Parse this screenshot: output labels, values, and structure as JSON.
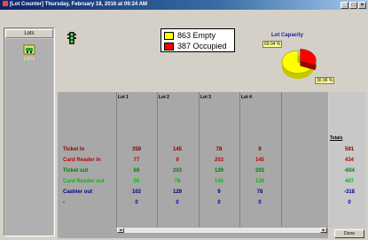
{
  "window": {
    "title": "[Lot Counter] Thursday, February  18, 2016 at 09:24 AM",
    "controls": [
      "_",
      "□",
      "×"
    ]
  },
  "lots_panel": {
    "header": "Lots",
    "item_label": "LOT1",
    "item_icon": "parking-lot-icon"
  },
  "status_icon": "traffic-light-icon",
  "legend": {
    "empty_label": "863 Empty",
    "occupied_label": "387 Occupied",
    "empty_color": "#ffff00",
    "occupied_color": "#ff0000"
  },
  "capacity": {
    "title": "Lot Capacity",
    "empty_pct_label": "69.04 %",
    "occupied_pct_label": "30.96 %",
    "empty_fraction": 0.6904,
    "occupied_fraction": 0.3096
  },
  "table": {
    "columns": [
      "Lot 1",
      "Lot 2",
      "Lot 3",
      "Lot 4"
    ],
    "totals_header": "Totals",
    "rows": [
      {
        "label": "Ticket In",
        "color": "#800000",
        "values": [
          "359",
          "145",
          "78",
          "9"
        ],
        "total": "591"
      },
      {
        "label": "Card Reader In",
        "color": "#c00000",
        "values": [
          "77",
          "9",
          "203",
          "145"
        ],
        "total": "434"
      },
      {
        "label": "Ticket out",
        "color": "#008000",
        "values": [
          "69",
          "203",
          "129",
          "203"
        ],
        "total": "-604"
      },
      {
        "label": "Card Reader out",
        "color": "#00c000",
        "values": [
          "55",
          "78",
          "145",
          "129"
        ],
        "total": "407"
      },
      {
        "label": "Cashier out",
        "color": "#000080",
        "values": [
          "102",
          "129",
          "9",
          "78"
        ],
        "total": "-318"
      },
      {
        "label": "-",
        "color": "#0000c0",
        "values": [
          "0",
          "0",
          "0",
          "0"
        ],
        "total": "0"
      }
    ]
  },
  "buttons": {
    "done": "Done"
  }
}
